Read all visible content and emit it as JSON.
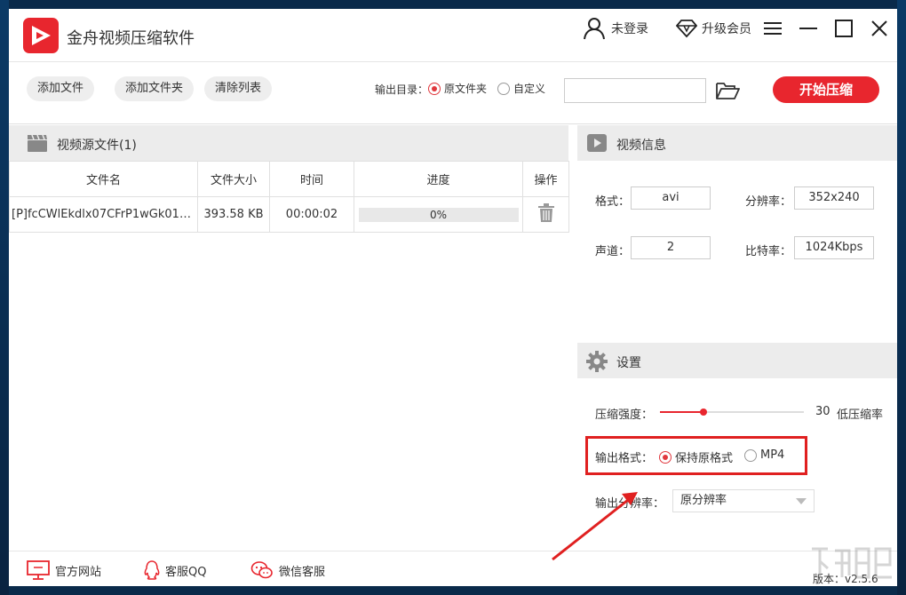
{
  "app": {
    "title": "金舟视频压缩软件"
  },
  "titlebar": {
    "login_label": "未登录",
    "vip_label": "升级会员"
  },
  "toolbar": {
    "add_file": "添加文件",
    "add_folder": "添加文件夹",
    "clear_list": "清除列表",
    "output_dir_label": "输出目录：",
    "option_original": "原文件夹",
    "option_custom": "自定义",
    "selected_option": "原文件夹",
    "path_value": "",
    "start_button": "开始压缩"
  },
  "file_panel": {
    "title": "视频源文件(1)",
    "columns": [
      "文件名",
      "文件大小",
      "时间",
      "进度",
      "操作"
    ],
    "rows": [
      {
        "name": "[P]fcCWlEkdlx07CFrP1wGk010...",
        "size": "393.58 KB",
        "duration": "00:00:02",
        "progress_label": "0%",
        "progress": 0
      }
    ]
  },
  "video_info": {
    "title": "视频信息",
    "format_label": "格式：",
    "format_value": "avi",
    "resolution_label": "分辨率：",
    "resolution_value": "352x240",
    "channels_label": "声道：",
    "channels_value": "2",
    "bitrate_label": "比特率：",
    "bitrate_value": "1024Kbps"
  },
  "settings": {
    "title": "设置",
    "strength_label": "压缩强度：",
    "strength_value": "30",
    "strength_fraction": 0.3,
    "strength_desc": "低压缩率",
    "output_format_label": "输出格式：",
    "format_keep": "保持原格式",
    "format_mp4": "MP4",
    "selected_format": "保持原格式",
    "output_res_label": "输出分辨率：",
    "output_res_value": "原分辨率"
  },
  "footer": {
    "website": "官方网站",
    "qq_support": "客服QQ",
    "wechat_support": "微信客服",
    "version": "版本：v2.5.6"
  },
  "colors": {
    "accent": "#e8262e",
    "highlight_box": "#e02020",
    "annotation_arrow": "#e02020"
  },
  "icons": [
    "logo-play-icon",
    "user-icon",
    "diamond-icon",
    "menu-icon",
    "minimize-icon",
    "maximize-icon",
    "close-icon",
    "folder-open-icon",
    "film-clapper-icon",
    "trash-icon",
    "video-play-icon",
    "gear-icon",
    "monitor-icon",
    "qq-penguin-icon",
    "wechat-icon"
  ]
}
